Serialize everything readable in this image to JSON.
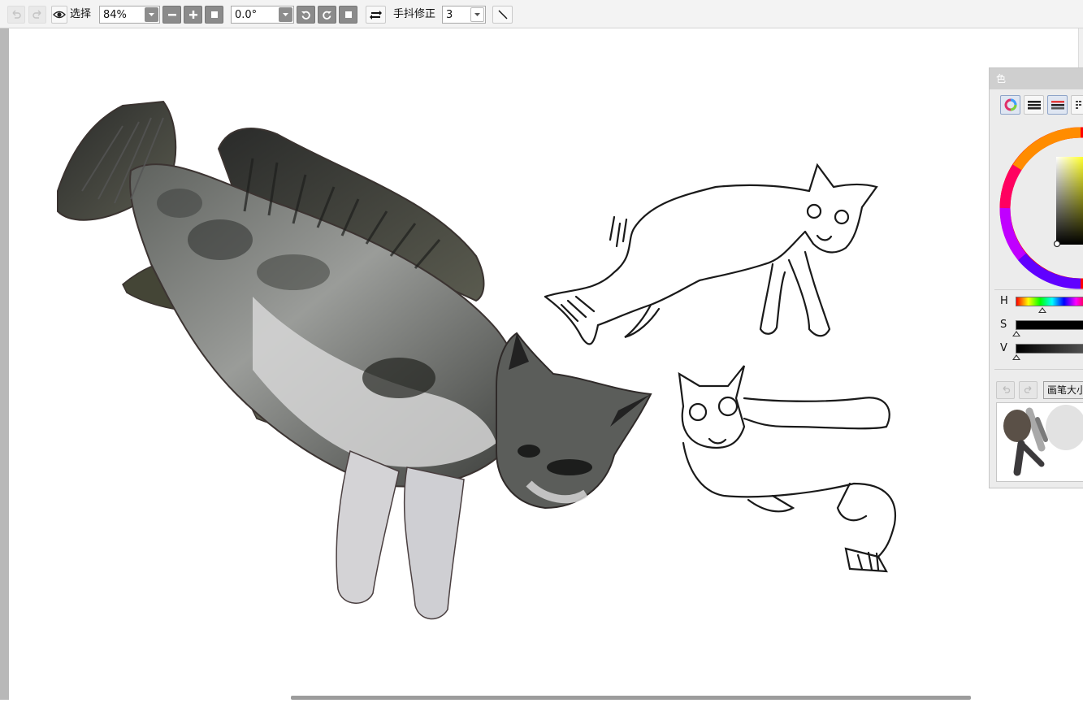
{
  "toolbar": {
    "view_label": "选择",
    "zoom": {
      "value": "84%"
    },
    "rotation": {
      "value": "0.0°"
    },
    "stabilizer_label": "手抖修正",
    "stabilizer": {
      "value": "3"
    }
  },
  "color_panel": {
    "title": "色",
    "sliders": [
      {
        "label": "H",
        "position": 0.3
      },
      {
        "label": "S",
        "position": 0.0
      },
      {
        "label": "V",
        "position": 0.0
      }
    ],
    "brush_size_label": "画笔大小"
  },
  "icons": {
    "undo": "undo-icon",
    "redo": "redo-icon",
    "eye": "eye-icon",
    "zoom_out": "minus-icon",
    "zoom_in": "plus-icon",
    "zoom_reset": "square-icon",
    "rotate_left": "rotate-left-icon",
    "rotate_right": "rotate-right-icon",
    "rotate_reset": "square-icon",
    "flip": "flip-arrows-icon",
    "stroke": "diagonal-line-icon"
  },
  "colors": {
    "toolbar_bg": "#f3f3f3",
    "button_dark": "#8b8b8b",
    "panel_bg": "#ececec",
    "panel_title_bg": "#cfcfcf"
  }
}
